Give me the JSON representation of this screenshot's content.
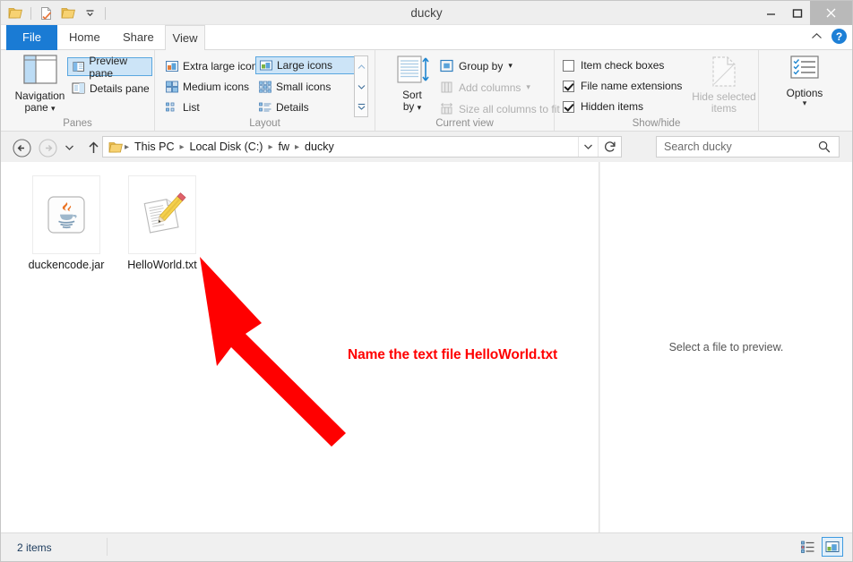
{
  "window": {
    "title": "ducky",
    "minimize_label": "Minimize",
    "maximize_label": "Maximize",
    "close_label": "Close"
  },
  "quick_access": {
    "items": [
      {
        "name": "folder-icon",
        "label": "Current folder"
      },
      {
        "name": "properties-icon",
        "label": "Properties"
      },
      {
        "name": "new-folder-icon",
        "label": "New folder"
      },
      {
        "name": "chevron-down-icon",
        "label": "Customize Quick Access Toolbar"
      }
    ]
  },
  "tabs": {
    "items": [
      {
        "label": "File",
        "active": false
      },
      {
        "label": "Home",
        "active": false
      },
      {
        "label": "Share",
        "active": false
      },
      {
        "label": "View",
        "active": true
      }
    ],
    "collapse_label": "Collapse the Ribbon",
    "help_label": "?"
  },
  "ribbon": {
    "groups": {
      "panes": {
        "title": "Panes",
        "navigation_pane": "Navigation\npane",
        "navigation_pane_line1": "Navigation",
        "navigation_pane_line2": "pane",
        "preview_pane": "Preview pane",
        "details_pane": "Details pane"
      },
      "layout": {
        "title": "Layout",
        "extra_large_icons": "Extra large icons",
        "large_icons": "Large icons",
        "medium_icons": "Medium icons",
        "small_icons": "Small icons",
        "list": "List",
        "details": "Details",
        "selected": "Large icons"
      },
      "current_view": {
        "title": "Current view",
        "sort_by_line1": "Sort",
        "sort_by_line2": "by",
        "group_by": "Group by",
        "add_columns": "Add columns",
        "size_all_columns": "Size all columns to fit"
      },
      "show_hide": {
        "title": "Show/hide",
        "item_check_boxes": "Item check boxes",
        "item_check_boxes_checked": false,
        "file_name_extensions": "File name extensions",
        "file_name_extensions_checked": true,
        "hidden_items": "Hidden items",
        "hidden_items_checked": true,
        "hide_selected_line1": "Hide selected",
        "hide_selected_line2": "items"
      },
      "options": {
        "title": "",
        "options_label": "Options"
      }
    }
  },
  "address_bar": {
    "back_label": "Back",
    "forward_label": "Forward",
    "recent_label": "Recent locations",
    "up_label": "Up",
    "breadcrumbs": [
      "This PC",
      "Local Disk (C:)",
      "fw",
      "ducky"
    ],
    "dropdown_label": "Previous locations",
    "refresh_label": "Refresh"
  },
  "search": {
    "placeholder": "Search ducky",
    "value": "",
    "icon": "search-icon"
  },
  "files": [
    {
      "name": "duckencode.jar",
      "icon": "java-jar-icon"
    },
    {
      "name": "HelloWorld.txt",
      "icon": "text-file-icon"
    }
  ],
  "annotation": {
    "text": "Name the text file HelloWorld.txt",
    "color": "#ff0000",
    "arrow": "red-arrow-pointing-up-left"
  },
  "preview_pane": {
    "message": "Select a file to preview."
  },
  "status_bar": {
    "item_count": "2 items",
    "details_view_label": "Details view",
    "large_icons_view_label": "Large icons view"
  },
  "colors": {
    "accent": "#1a7bd4",
    "selection": "#cce4f7",
    "selection_border": "#5aa7e0",
    "annotation_red": "#ff0000",
    "ribbon_bg": "#f6f6f6"
  }
}
